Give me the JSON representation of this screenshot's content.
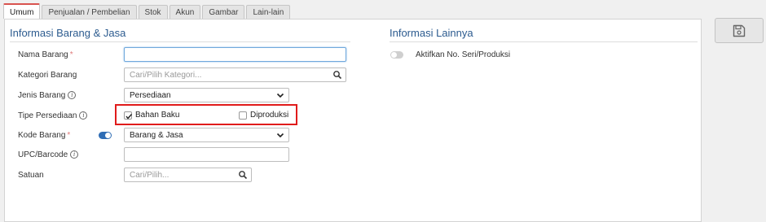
{
  "tabs": [
    {
      "label": "Umum",
      "active": true
    },
    {
      "label": "Penjualan / Pembelian"
    },
    {
      "label": "Stok"
    },
    {
      "label": "Akun"
    },
    {
      "label": "Gambar"
    },
    {
      "label": "Lain-lain"
    }
  ],
  "left_section": {
    "title": "Informasi Barang & Jasa",
    "fields": {
      "nama_barang": {
        "label": "Nama Barang",
        "required_mark": "*",
        "value": ""
      },
      "kategori_barang": {
        "label": "Kategori Barang",
        "placeholder": "Cari/Pilih Kategori..."
      },
      "jenis_barang": {
        "label": "Jenis Barang",
        "info": "i",
        "value": "Persediaan"
      },
      "tipe_persediaan": {
        "label": "Tipe Persediaan",
        "info": "i",
        "options": [
          {
            "label": "Bahan Baku",
            "checked": true
          },
          {
            "label": "Diproduksi",
            "checked": false
          }
        ]
      },
      "kode_barang": {
        "label": "Kode Barang",
        "required_mark": "*",
        "toggle_on": true,
        "value": "Barang & Jasa"
      },
      "upc_barcode": {
        "label": "UPC/Barcode",
        "info": "i",
        "value": ""
      },
      "satuan": {
        "label": "Satuan",
        "placeholder": "Cari/Pilih..."
      }
    }
  },
  "right_section": {
    "title": "Informasi Lainnya",
    "serial_toggle": {
      "label": "Aktifkan No. Seri/Produksi",
      "on": false
    }
  },
  "icons": {
    "search": "search-icon",
    "dropdown": "chevron-down-icon",
    "save": "save-icon",
    "check": "checkmark-icon"
  },
  "colors": {
    "accent": "#2f6db5",
    "highlight": "#e01b1b",
    "title": "#2c5b8f",
    "active_tab_top": "#d9534f"
  }
}
